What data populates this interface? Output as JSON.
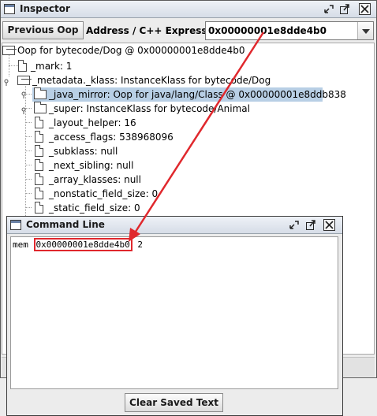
{
  "inspector": {
    "title": "Inspector",
    "prev_button": "Previous Oop",
    "address_label": "Address / C++ Expression:",
    "address_value": "0x00000001e8dde4b0",
    "tree": [
      {
        "label": "Oop for bytecode/Dog @ 0x00000001e8dde4b0"
      },
      {
        "label": "_mark: 1"
      },
      {
        "label": "_metadata._klass: InstanceKlass for bytecode/Dog"
      },
      {
        "label": "_java_mirror: Oop for java/lang/Class @ 0x00000001e8ddb838"
      },
      {
        "label": "_super: InstanceKlass for bytecode/Animal"
      },
      {
        "label": "_layout_helper: 16"
      },
      {
        "label": "_access_flags: 538968096"
      },
      {
        "label": "_subklass: null"
      },
      {
        "label": "_next_sibling: null"
      },
      {
        "label": "_array_klasses: null"
      },
      {
        "label": "_nonstatic_field_size: 0"
      },
      {
        "label": "_static_field_size: 0"
      }
    ]
  },
  "command_line": {
    "title": "Command Line",
    "cmd": "mem",
    "address": "0x00000001e8dde4b0",
    "arg": "2",
    "clear_button": "Clear Saved Text"
  },
  "colors": {
    "annotation_red": "#e0282d",
    "selection": "#b8cfe5"
  },
  "icons": [
    "window-icon",
    "minimize-icon",
    "maximize-icon",
    "close-icon",
    "dropdown-arrow-icon",
    "document-icon",
    "folder-icon",
    "key-icon"
  ]
}
